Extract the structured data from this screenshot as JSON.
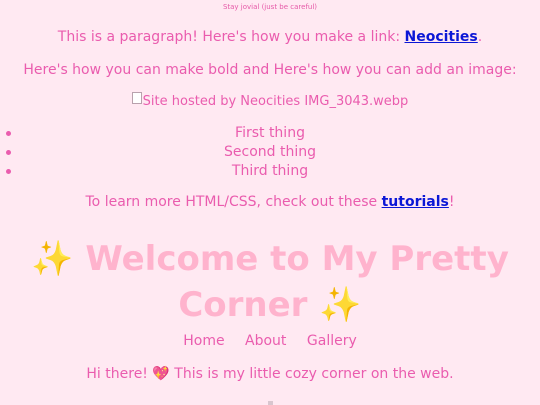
{
  "top_note": "Stay jovial (just be careful)",
  "paragraph1": {
    "text": "This is a paragraph! Here's how you make a link: ",
    "link": "Neocities",
    "end": "."
  },
  "paragraph2": {
    "text": "Here's how you can make bold and Here's how you can add an image:"
  },
  "image": {
    "alt": "Site hosted by Neocities IMG_3043.webp"
  },
  "list": [
    "First thing",
    "Second thing",
    "Third thing"
  ],
  "paragraph3": {
    "text": "To learn more HTML/CSS, check out these ",
    "link": "tutorials",
    "end": "!"
  },
  "heading": {
    "sparkle": "✨",
    "line1": "Welcome to My Pretty",
    "line2": "Corner"
  },
  "nav": [
    "Home",
    "About",
    "Gallery"
  ],
  "greeting": {
    "before": "Hi there! ",
    "heart": "💖",
    "after": " This is my little cozy corner on the web."
  },
  "colors": {
    "background": "#ffe9f2",
    "text": "#ea5cae",
    "link": "#0b17d6",
    "heading": "#ffb3cd"
  }
}
